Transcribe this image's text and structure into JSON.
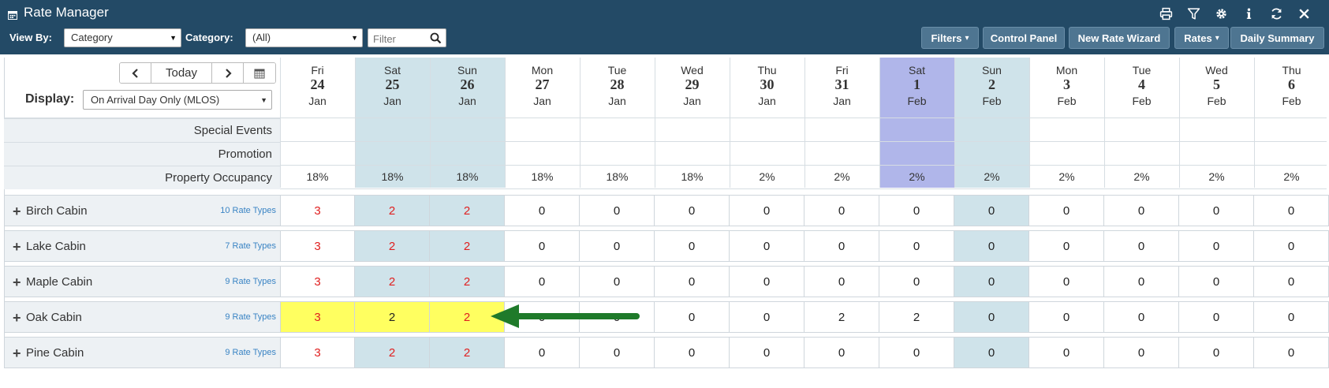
{
  "header": {
    "title": "Rate Manager",
    "icons": [
      "print-icon",
      "filter-icon",
      "gear-icon",
      "info-icon",
      "refresh-icon",
      "close-icon"
    ],
    "view_by_label": "View By:",
    "view_by_value": "Category",
    "category_label": "Category:",
    "category_value": "(All)",
    "filter_placeholder": "Filter",
    "buttons": {
      "filters": "Filters",
      "control_panel": "Control Panel",
      "new_rate_wizard": "New Rate Wizard",
      "rates": "Rates",
      "daily_summary": "Daily Summary"
    }
  },
  "nav": {
    "today": "Today",
    "display_label": "Display:",
    "display_value": "On Arrival Day Only (MLOS)"
  },
  "dates": [
    {
      "dow": "Fri",
      "day": "24",
      "mon": "Jan",
      "shade": "none"
    },
    {
      "dow": "Sat",
      "day": "25",
      "mon": "Jan",
      "shade": "weekend"
    },
    {
      "dow": "Sun",
      "day": "26",
      "mon": "Jan",
      "shade": "weekend"
    },
    {
      "dow": "Mon",
      "day": "27",
      "mon": "Jan",
      "shade": "none"
    },
    {
      "dow": "Tue",
      "day": "28",
      "mon": "Jan",
      "shade": "none"
    },
    {
      "dow": "Wed",
      "day": "29",
      "mon": "Jan",
      "shade": "none"
    },
    {
      "dow": "Thu",
      "day": "30",
      "mon": "Jan",
      "shade": "none"
    },
    {
      "dow": "Fri",
      "day": "31",
      "mon": "Jan",
      "shade": "none"
    },
    {
      "dow": "Sat",
      "day": "1",
      "mon": "Feb",
      "shade": "selected"
    },
    {
      "dow": "Sun",
      "day": "2",
      "mon": "Feb",
      "shade": "weekend"
    },
    {
      "dow": "Mon",
      "day": "3",
      "mon": "Feb",
      "shade": "none"
    },
    {
      "dow": "Tue",
      "day": "4",
      "mon": "Feb",
      "shade": "none"
    },
    {
      "dow": "Wed",
      "day": "5",
      "mon": "Feb",
      "shade": "none"
    },
    {
      "dow": "Thu",
      "day": "6",
      "mon": "Feb",
      "shade": "none"
    }
  ],
  "info_rows": {
    "special_events": "Special Events",
    "promotion": "Promotion",
    "property_occupancy": "Property Occupancy"
  },
  "occupancy": [
    "18%",
    "18%",
    "18%",
    "18%",
    "18%",
    "18%",
    "2%",
    "2%",
    "2%",
    "2%",
    "2%",
    "2%",
    "2%",
    "2%"
  ],
  "rooms": [
    {
      "name": "Birch Cabin",
      "rate_types": "10 Rate Types",
      "values": [
        "3",
        "2",
        "2",
        "0",
        "0",
        "0",
        "0",
        "0",
        "0",
        "0",
        "0",
        "0",
        "0",
        "0"
      ],
      "highlight": [
        false,
        false,
        false,
        false,
        false,
        false,
        false,
        false,
        false,
        false,
        false,
        false,
        false,
        false
      ]
    },
    {
      "name": "Lake Cabin",
      "rate_types": "7 Rate Types",
      "values": [
        "3",
        "2",
        "2",
        "0",
        "0",
        "0",
        "0",
        "0",
        "0",
        "0",
        "0",
        "0",
        "0",
        "0"
      ],
      "highlight": [
        false,
        false,
        false,
        false,
        false,
        false,
        false,
        false,
        false,
        false,
        false,
        false,
        false,
        false
      ]
    },
    {
      "name": "Maple Cabin",
      "rate_types": "9 Rate Types",
      "values": [
        "3",
        "2",
        "2",
        "0",
        "0",
        "0",
        "0",
        "0",
        "0",
        "0",
        "0",
        "0",
        "0",
        "0"
      ],
      "highlight": [
        false,
        false,
        false,
        false,
        false,
        false,
        false,
        false,
        false,
        false,
        false,
        false,
        false,
        false
      ]
    },
    {
      "name": "Oak Cabin",
      "rate_types": "9 Rate Types",
      "values": [
        "3",
        "2",
        "2",
        "0",
        "0",
        "0",
        "0",
        "2",
        "2",
        "0",
        "0",
        "0",
        "0",
        "0"
      ],
      "highlight": [
        true,
        true,
        true,
        false,
        false,
        false,
        false,
        false,
        false,
        false,
        false,
        false,
        false,
        false
      ]
    },
    {
      "name": "Pine Cabin",
      "rate_types": "9 Rate Types",
      "values": [
        "3",
        "2",
        "2",
        "0",
        "0",
        "0",
        "0",
        "0",
        "0",
        "0",
        "0",
        "0",
        "0",
        "0"
      ],
      "highlight": [
        false,
        false,
        false,
        false,
        false,
        false,
        false,
        false,
        false,
        false,
        false,
        false,
        false,
        false
      ]
    }
  ],
  "colors": {
    "header_bg": "#234a66",
    "weekend": "#cfe3ea",
    "selected": "#b0b6ea",
    "highlight": "#ffff60",
    "red_value": "#e02020",
    "arrow": "#1f7a2a",
    "label_bg": "#edf1f4"
  }
}
